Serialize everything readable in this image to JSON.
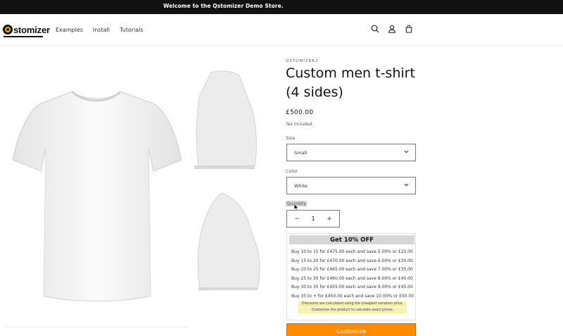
{
  "announcement": {
    "text": "Welcome to the Qstomizer Demo Store."
  },
  "header": {
    "logo_text": "stomizer",
    "nav": [
      "Examples",
      "Install",
      "Tutorials"
    ],
    "icons": [
      "search-icon",
      "account-icon",
      "cart-icon"
    ]
  },
  "product": {
    "vendor": "QSTOMIZER2",
    "title": "Custom men t-shirt (4 sides)",
    "price": "£500.00",
    "tax_note": "Tax included.",
    "size_label": "Size",
    "size_value": "Small",
    "color_label": "Color",
    "color_value": "White",
    "quantity_label": "Quantity",
    "quantity_value": "1",
    "minus": "−",
    "plus": "+"
  },
  "discount": {
    "heading": "Get 10% OFF",
    "tiers": [
      "Buy 10 to 15 for £475.00 each and save 5.00% or £25.00",
      "Buy 15 to 20 for £470.00 each and save 6.00% or £30.00",
      "Buy 20 to 25 for £465.00 each and save 7.00% or £35.00",
      "Buy 25 to 30 for £460.00 each and save 8.00% or £40.00",
      "Buy 30 to 35 for £455.00 each and save 9.00% or £45.00",
      "Buy 35 to + for £450.00 each and save 10.00% or £50.00"
    ],
    "note_1": "Discounts are calculated using the cheapest variation price.",
    "note_2": "Customize the product to calculate exact prices."
  },
  "customize_button": "Customize",
  "colors": {
    "announcement_bg": "#111111",
    "accent": "#ff8c00",
    "discount_head_bg": "#d6d6d6",
    "note_bg": "#f7f2a8"
  }
}
